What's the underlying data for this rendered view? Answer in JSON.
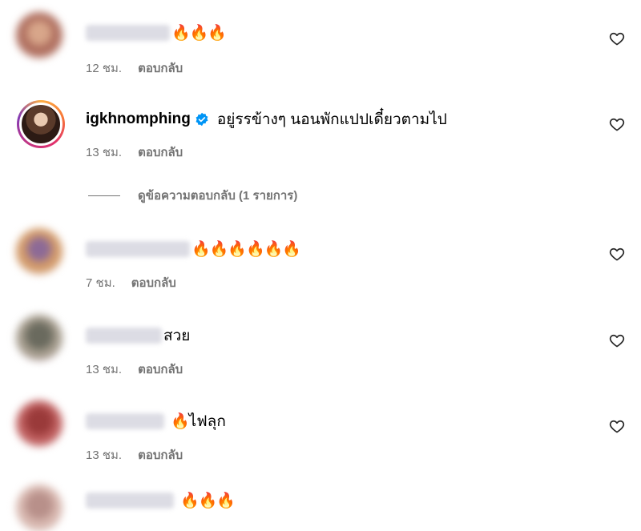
{
  "comments": [
    {
      "text": "",
      "flames": "🔥🔥🔥",
      "time": "12 ชม.",
      "reply": "ตอบกลับ"
    },
    {
      "username": "igkhnomphing",
      "text": "อยู่รรข้างๆ นอนพักแปปเดี๋ยวตามไป",
      "flames": "",
      "time": "13 ชม.",
      "reply": "ตอบกลับ"
    },
    {
      "text": "",
      "flames": "🔥🔥🔥🔥🔥🔥",
      "time": "7 ชม.",
      "reply": "ตอบกลับ"
    },
    {
      "text": "สวย",
      "flames": "",
      "time": "13 ชม.",
      "reply": "ตอบกลับ"
    },
    {
      "text": "ไฟลุก",
      "flames": "🔥",
      "time": "13 ชม.",
      "reply": "ตอบกลับ"
    },
    {
      "text": "",
      "flames": "🔥🔥🔥",
      "time": "",
      "reply": ""
    }
  ],
  "view_replies": "ดูข้อความตอบกลับ (1 รายการ)",
  "icons": {
    "like": "heart-outline-icon",
    "verified": "verified-badge-icon"
  },
  "colors": {
    "verified": "#0095f6",
    "secondary_text": "#737373"
  }
}
